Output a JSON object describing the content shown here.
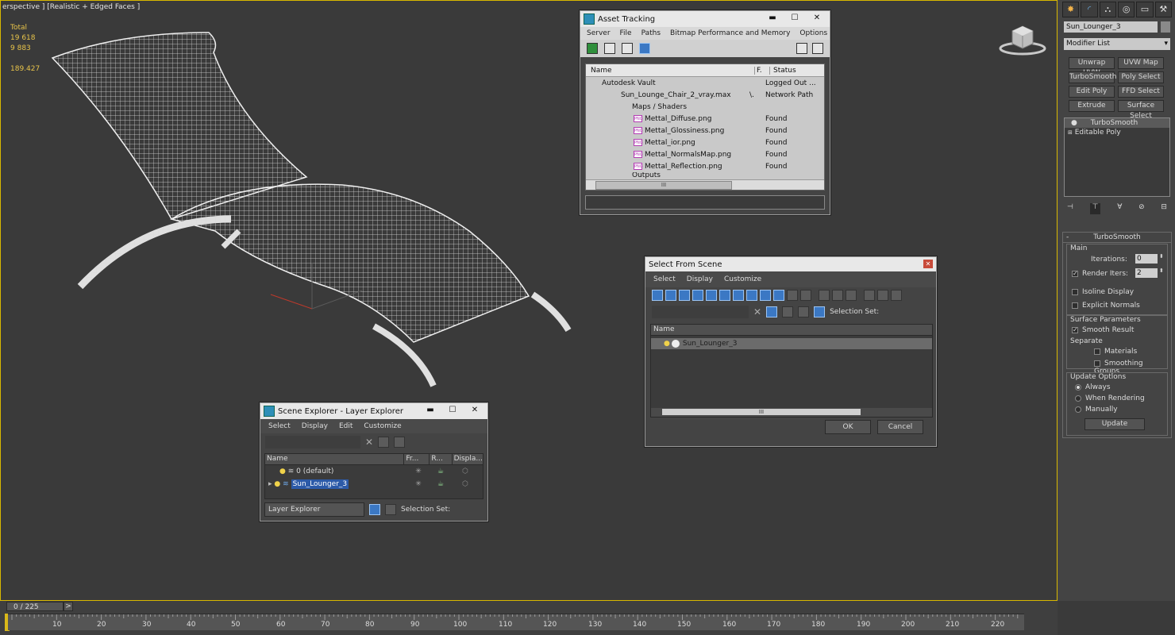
{
  "viewport": {
    "label": "erspective ] [Realistic + Edged Faces ]",
    "stats": {
      "total_label": "Total",
      "polys": "19 618",
      "verts": "9 883",
      "fps": "189.427"
    }
  },
  "asset_tracking": {
    "title": "Asset Tracking",
    "menu": [
      "Server",
      "File",
      "Paths",
      "Bitmap Performance and Memory",
      "Options"
    ],
    "columns": [
      "Name",
      "F.",
      "Status"
    ],
    "rows": [
      {
        "name": "Autodesk Vault",
        "f": "",
        "status": "Logged Out ..."
      },
      {
        "name": "Sun_Lounge_Chair_2_vray.max",
        "f": "\\.",
        "status": "Network Path"
      },
      {
        "name": "Maps / Shaders",
        "f": "",
        "status": ""
      },
      {
        "name": "Mettal_Diffuse.png",
        "f": "",
        "status": "Found"
      },
      {
        "name": "Mettal_Glossiness.png",
        "f": "",
        "status": "Found"
      },
      {
        "name": "Mettal_ior.png",
        "f": "",
        "status": "Found"
      },
      {
        "name": "Mettal_NormalsMap.png",
        "f": "",
        "status": "Found"
      },
      {
        "name": "Mettal_Reflection.png",
        "f": "",
        "status": "Found"
      },
      {
        "name": "Outputs",
        "f": "",
        "status": ""
      }
    ],
    "file_icon": "PNG",
    "scroll_grip": "III",
    "window_buttons": {
      "min": "▬",
      "max": "☐",
      "close": "✕"
    }
  },
  "select_from_scene": {
    "title": "Select From Scene",
    "menu": [
      "Select",
      "Display",
      "Customize"
    ],
    "selection_set_label": "Selection Set:",
    "name_col": "Name",
    "item": "Sun_Lounger_3",
    "ok": "OK",
    "cancel": "Cancel",
    "close": "✕",
    "scroll_grip": "III"
  },
  "scene_explorer": {
    "title": "Scene Explorer - Layer Explorer",
    "menu": [
      "Select",
      "Display",
      "Edit",
      "Customize"
    ],
    "columns": [
      "Name",
      "Fr...",
      "R...",
      "Displa..."
    ],
    "rows": [
      {
        "name": "0 (default)"
      },
      {
        "name": "Sun_Lounger_3"
      }
    ],
    "explorer_select": "Layer Explorer",
    "selection_set_label": "Selection Set:",
    "window_buttons": {
      "min": "▬",
      "max": "☐",
      "close": "✕"
    }
  },
  "command_panel": {
    "object_name": "Sun_Lounger_3",
    "modifier_list": "Modifier List",
    "modifier_buttons": [
      "Unwrap UVW",
      "UVW Map",
      "TurboSmooth",
      "Poly Select",
      "Edit Poly",
      "FFD Select",
      "Extrude",
      "Surface Select"
    ],
    "stack": [
      "TurboSmooth",
      "Editable Poly"
    ],
    "rollout_title": "TurboSmooth",
    "main_group": "Main",
    "iterations_label": "Iterations:",
    "iterations_value": "0",
    "render_iters_label": "Render Iters:",
    "render_iters_value": "2",
    "isoline_label": "Isoline Display",
    "explicit_normals_label": "Explicit Normals",
    "surface_group": "Surface Parameters",
    "smooth_result_label": "Smooth Result",
    "separate_label": "Separate",
    "materials_label": "Materials",
    "smoothing_groups_label": "Smoothing Groups",
    "update_group": "Update Options",
    "always_label": "Always",
    "when_rendering_label": "When Rendering",
    "manually_label": "Manually",
    "update_button": "Update"
  },
  "timeline": {
    "frame_counter": "0 / 225",
    "next": ">",
    "ticks": [
      "10",
      "20",
      "30",
      "40",
      "50",
      "60",
      "70",
      "80",
      "90",
      "100",
      "110",
      "120",
      "130",
      "140",
      "150",
      "160",
      "170",
      "180",
      "190",
      "200",
      "210",
      "220"
    ]
  }
}
